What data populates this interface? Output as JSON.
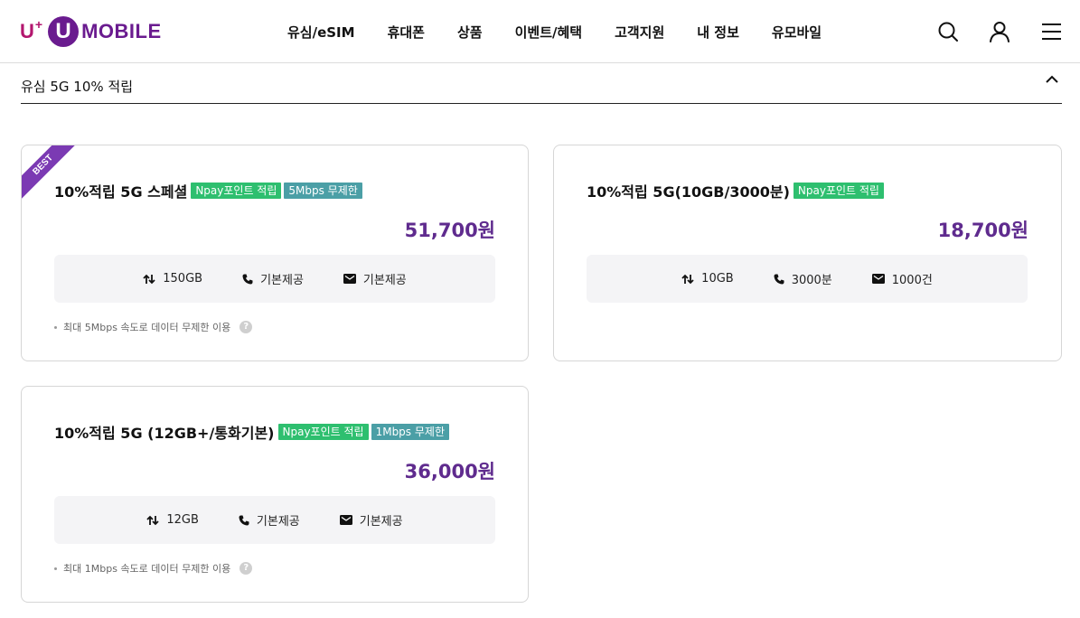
{
  "brand": {
    "prefix": "U",
    "plus": "+",
    "circle": "U",
    "word": "MOBILE"
  },
  "nav": [
    "유심/eSIM",
    "휴대폰",
    "상품",
    "이벤트/혜택",
    "고객지원",
    "내 정보",
    "유모바일"
  ],
  "header_icons": [
    "search-icon",
    "user-icon",
    "menu-icon"
  ],
  "section": {
    "title": "유심 5G 10% 적립"
  },
  "plans": [
    {
      "badge": "BEST",
      "name": "10%적립 5G 스페셜",
      "tags": [
        {
          "label": "Npay포인트 적립",
          "color": "#2ebf6f"
        },
        {
          "label": "5Mbps 무제한",
          "color": "#4b9fa6"
        }
      ],
      "price": "51,700원",
      "specs": {
        "data": "150GB",
        "voice": "기본제공",
        "sms": "기본제공"
      },
      "note": "최대 5Mbps 속도로 데이터 무제한 이용",
      "help": "?"
    },
    {
      "name": "10%적립 5G(10GB/3000분)",
      "tags": [
        {
          "label": "Npay포인트 적립",
          "color": "#2ebf6f"
        }
      ],
      "price": "18,700원",
      "specs": {
        "data": "10GB",
        "voice": "3000분",
        "sms": "1000건"
      }
    },
    {
      "name": "10%적립 5G (12GB+/통화기본)",
      "tags": [
        {
          "label": "Npay포인트 적립",
          "color": "#2ebf6f"
        },
        {
          "label": "1Mbps 무제한",
          "color": "#4b9fa6"
        }
      ],
      "price": "36,000원",
      "specs": {
        "data": "12GB",
        "voice": "기본제공",
        "sms": "기본제공"
      },
      "note": "최대 1Mbps 속도로 데이터 무제한 이용",
      "help": "?"
    }
  ],
  "colors": {
    "brand_purple": "#6a1b8f",
    "price_purple": "#5f2b8e",
    "tag_green": "#2ebf6f",
    "tag_teal": "#4b9fa6"
  }
}
